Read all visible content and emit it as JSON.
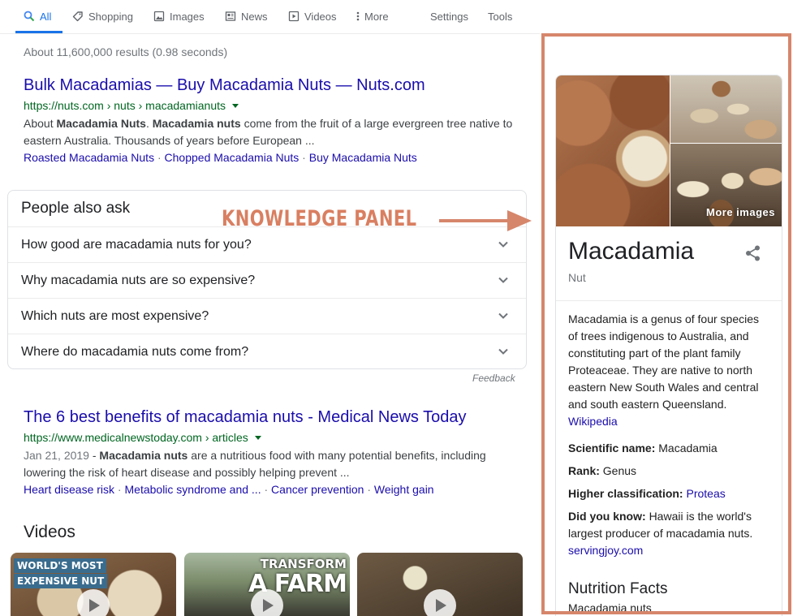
{
  "tabs": {
    "all": "All",
    "shopping": "Shopping",
    "images": "Images",
    "news": "News",
    "videos": "Videos",
    "more": "More",
    "settings": "Settings",
    "tools": "Tools"
  },
  "result_stats": "About 11,600,000 results (0.98 seconds)",
  "results": [
    {
      "title": "Bulk Macadamias — Buy Macadamia Nuts — Nuts.com",
      "url": "https://nuts.com › nuts › macadamianuts",
      "snippet_1": "About ",
      "snippet_bold_1": "Macadamia Nuts",
      "snippet_2": ". ",
      "snippet_bold_2": "Macadamia nuts",
      "snippet_3": " come from the fruit of a large evergreen tree native to eastern Australia. Thousands of years before European ...",
      "sitelinks": [
        "Roasted Macadamia Nuts",
        "Chopped Macadamia Nuts",
        "Buy Macadamia Nuts"
      ]
    },
    {
      "title": "The 6 best benefits of macadamia nuts - Medical News Today",
      "url": "https://www.medicalnewstoday.com › articles",
      "date": "Jan 21, 2019",
      "snippet_1": " - ",
      "snippet_bold_1": "Macadamia nuts",
      "snippet_2": " are a nutritious food with many potential benefits, including lowering the risk of heart disease and possibly helping prevent ...",
      "sitelinks": [
        "Heart disease risk",
        "Metabolic syndrome and ...",
        "Cancer prevention",
        "Weight gain"
      ]
    }
  ],
  "people_also_ask": {
    "title": "People also ask",
    "questions": [
      "How good are macadamia nuts for you?",
      "Why macadamia nuts are so expensive?",
      "Which nuts are most expensive?",
      "Where do macadamia nuts come from?"
    ],
    "feedback": "Feedback"
  },
  "videos": {
    "title": "Videos",
    "items": [
      {
        "caption_1": "WORLD'S MOST",
        "caption_2": "EXPENSIVE NUT"
      },
      {
        "caption_1": "TRANSFORM",
        "caption_2": "A FARM"
      },
      {}
    ]
  },
  "annotation": {
    "label": "KNOWLEDGE PANEL",
    "color": "#d6866b"
  },
  "knowledge_panel": {
    "more_images": "More images",
    "title": "Macadamia",
    "subtitle": "Nut",
    "description": "Macadamia is a genus of four species of trees indigenous to Australia, and constituting part of the plant family Proteaceae. They are native to north eastern New South Wales and central and south eastern Queensland.",
    "description_source": "Wikipedia",
    "facts": {
      "scientific_name_label": "Scientific name:",
      "scientific_name_value": "Macadamia",
      "rank_label": "Rank:",
      "rank_value": "Genus",
      "higher_classification_label": "Higher classification:",
      "higher_classification_value": "Proteas",
      "did_you_know_label": "Did you know:",
      "did_you_know_value": "Hawaii is the world's largest producer of macadamia nuts.",
      "did_you_know_source": "servingjoy.com"
    },
    "nutrition_title": "Nutrition Facts",
    "nutrition_subtitle": "Macadamia nuts"
  },
  "colors": {
    "link": "#1a0dab",
    "url_green": "#006621",
    "accent_blue": "#1a73e8",
    "annotation": "#d6866b"
  }
}
